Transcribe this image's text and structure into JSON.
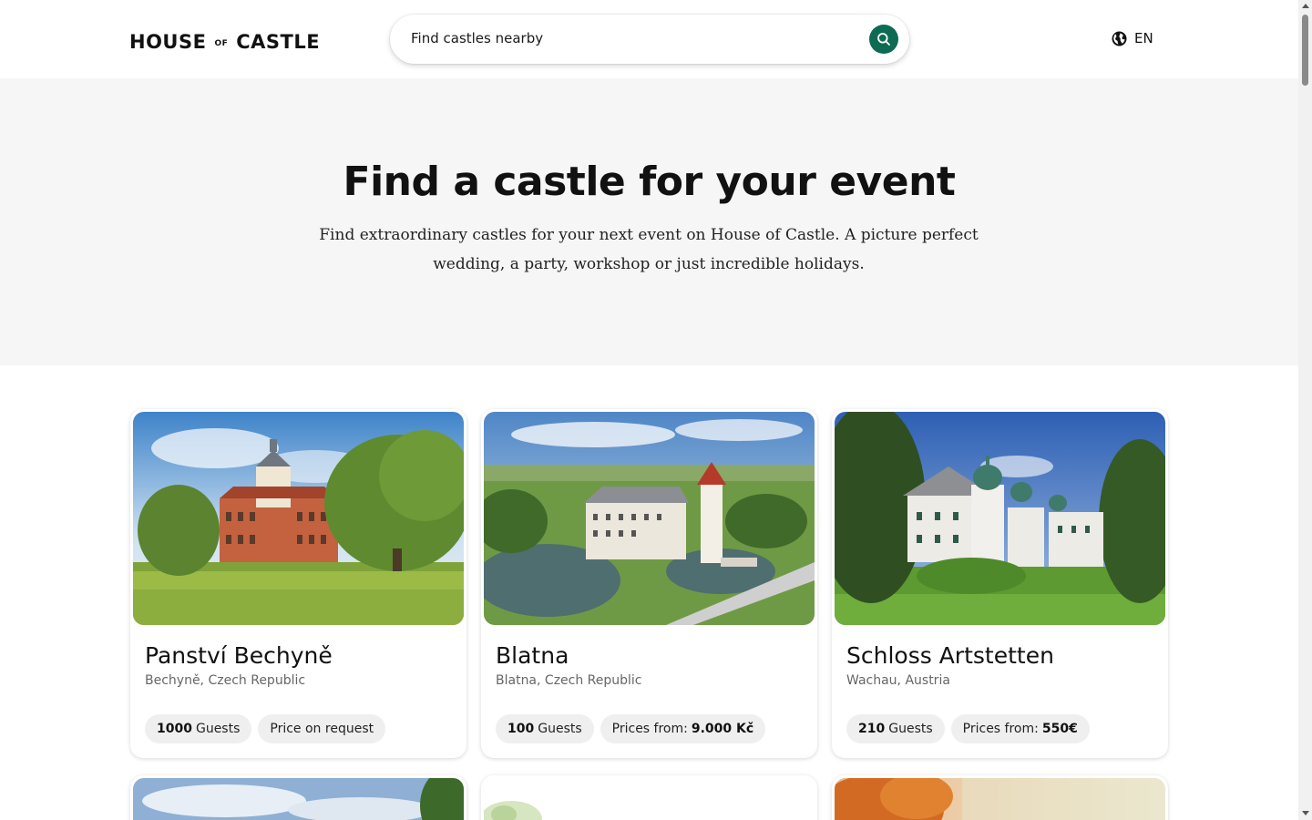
{
  "header": {
    "logo": {
      "word1": "HOUSE",
      "word2": "OF",
      "word3": "CASTLE"
    },
    "search": {
      "placeholder": "Find castles nearby"
    },
    "language": "EN"
  },
  "hero": {
    "title": "Find a castle for your event",
    "description": "Find extraordinary castles for your next event on House of Castle. A picture perfect wedding, a party, workshop or just incredible holidays."
  },
  "listings": [
    {
      "name": "Panství Bechyně",
      "location": "Bechyně, Czech Republic",
      "guests_count": "1000",
      "guests_label": "Guests",
      "price_label": "Price on request",
      "price_value": ""
    },
    {
      "name": "Blatna",
      "location": "Blatna, Czech Republic",
      "guests_count": "100",
      "guests_label": "Guests",
      "price_label": "Prices from:",
      "price_value": "9.000 Kč"
    },
    {
      "name": "Schloss Artstetten",
      "location": "Wachau, Austria",
      "guests_count": "210",
      "guests_label": "Guests",
      "price_label": "Prices from:",
      "price_value": "550€"
    }
  ],
  "colors": {
    "accent": "#0d6b53",
    "hero_bg": "#f6f6f6",
    "chip_bg": "#efefef"
  },
  "icons": {
    "search": "search-icon",
    "language": "globe-icon"
  }
}
